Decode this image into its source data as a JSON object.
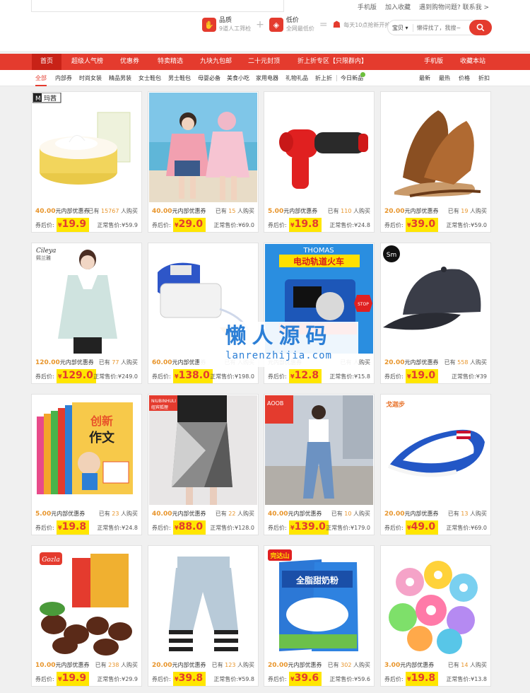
{
  "toplinks": [
    "手机版",
    "加入收藏",
    "遇到购物问题? 联系我 >"
  ],
  "features": {
    "f1_title": "品质",
    "f1_sub": "9道人工筛检",
    "f2_title": "低价",
    "f2_sub": "全网最低价",
    "f3": "每天10点抢新开抢"
  },
  "search": {
    "category": "宝贝",
    "placeholder": "懒得找了，我搜~",
    "button_icon": "search-icon"
  },
  "nav": {
    "items": [
      "首页",
      "超级人气榜",
      "优惠券",
      "特卖精选",
      "九块九包邮",
      "二十元封顶",
      "折上折专区【只限群内】"
    ],
    "right": [
      "手机版",
      "收藏本站"
    ]
  },
  "subnav": {
    "items": [
      "全部",
      "内部券",
      "时尚女装",
      "精品男装",
      "女士鞋包",
      "男士鞋包",
      "母婴必备",
      "美食小吃",
      "家用电器",
      "礼物礼品",
      "折上折",
      "今日新品"
    ],
    "sorts": [
      "最新",
      "最热",
      "价格",
      "折扣"
    ]
  },
  "labels": {
    "coupon_suffix": "元内部优惠券",
    "bought_prefix": "已有",
    "bought_suffix": "人购买",
    "after": "券后价:",
    "normal": "正常售价:",
    "yen": "¥"
  },
  "products": [
    {
      "coupon": "40.00",
      "sold": "15767",
      "price": "19.9",
      "normal": "59.9"
    },
    {
      "coupon": "40.00",
      "sold": "15",
      "price": "29.0",
      "normal": "69.0"
    },
    {
      "coupon": "5.00",
      "sold": "110",
      "price": "19.8",
      "normal": "24.8"
    },
    {
      "coupon": "20.00",
      "sold": "19",
      "price": "39.0",
      "normal": "59.0"
    },
    {
      "coupon": "120.00",
      "sold": "77",
      "price": "129.0",
      "normal": "249.0"
    },
    {
      "coupon": "60.00",
      "sold": "",
      "price": "138.0",
      "normal": "198.0"
    },
    {
      "coupon": "",
      "sold": "",
      "price": "12.8",
      "normal": "15.8"
    },
    {
      "coupon": "20.00",
      "sold": "558",
      "price": "19.0",
      "normal": "39"
    },
    {
      "coupon": "5.00",
      "sold": "23",
      "price": "19.8",
      "normal": "24.8"
    },
    {
      "coupon": "40.00",
      "sold": "22",
      "price": "88.0",
      "normal": "128.0"
    },
    {
      "coupon": "40.00",
      "sold": "10",
      "price": "139.0",
      "normal": "179.0"
    },
    {
      "coupon": "20.00",
      "sold": "13",
      "price": "49.0",
      "normal": "69.0"
    },
    {
      "coupon": "10.00",
      "sold": "238",
      "price": "19.9",
      "normal": "29.9"
    },
    {
      "coupon": "20.00",
      "sold": "123",
      "price": "39.8",
      "normal": "59.8"
    },
    {
      "coupon": "20.00",
      "sold": "302",
      "price": "39.6",
      "normal": "59.6"
    },
    {
      "coupon": "3.00",
      "sold": "14",
      "price": "19.8",
      "normal": "13.8"
    }
  ],
  "image_text": {
    "p1_brand": "玛茜",
    "p5_brand": "Cileya",
    "p5_brand_cn": "熙兰雅",
    "p7_brand": "THOMAS",
    "p7_title": "电动轨道火车",
    "p7_stop": "STOP",
    "p8_logo": "Sm",
    "p9_t1": "创新",
    "p9_t2": "作文",
    "p10_brand": "NIUBINHULI",
    "p10_sub": "纽宾狐狸",
    "p11_brand": "AOOB",
    "p12_brand": "戈迦步",
    "p13_brand": "Gozla",
    "p15_brand": "完达山",
    "p15_name": "全脂甜奶粉"
  },
  "watermark": {
    "cn": "懒人源码",
    "url": "lanrenzhijia.com"
  }
}
